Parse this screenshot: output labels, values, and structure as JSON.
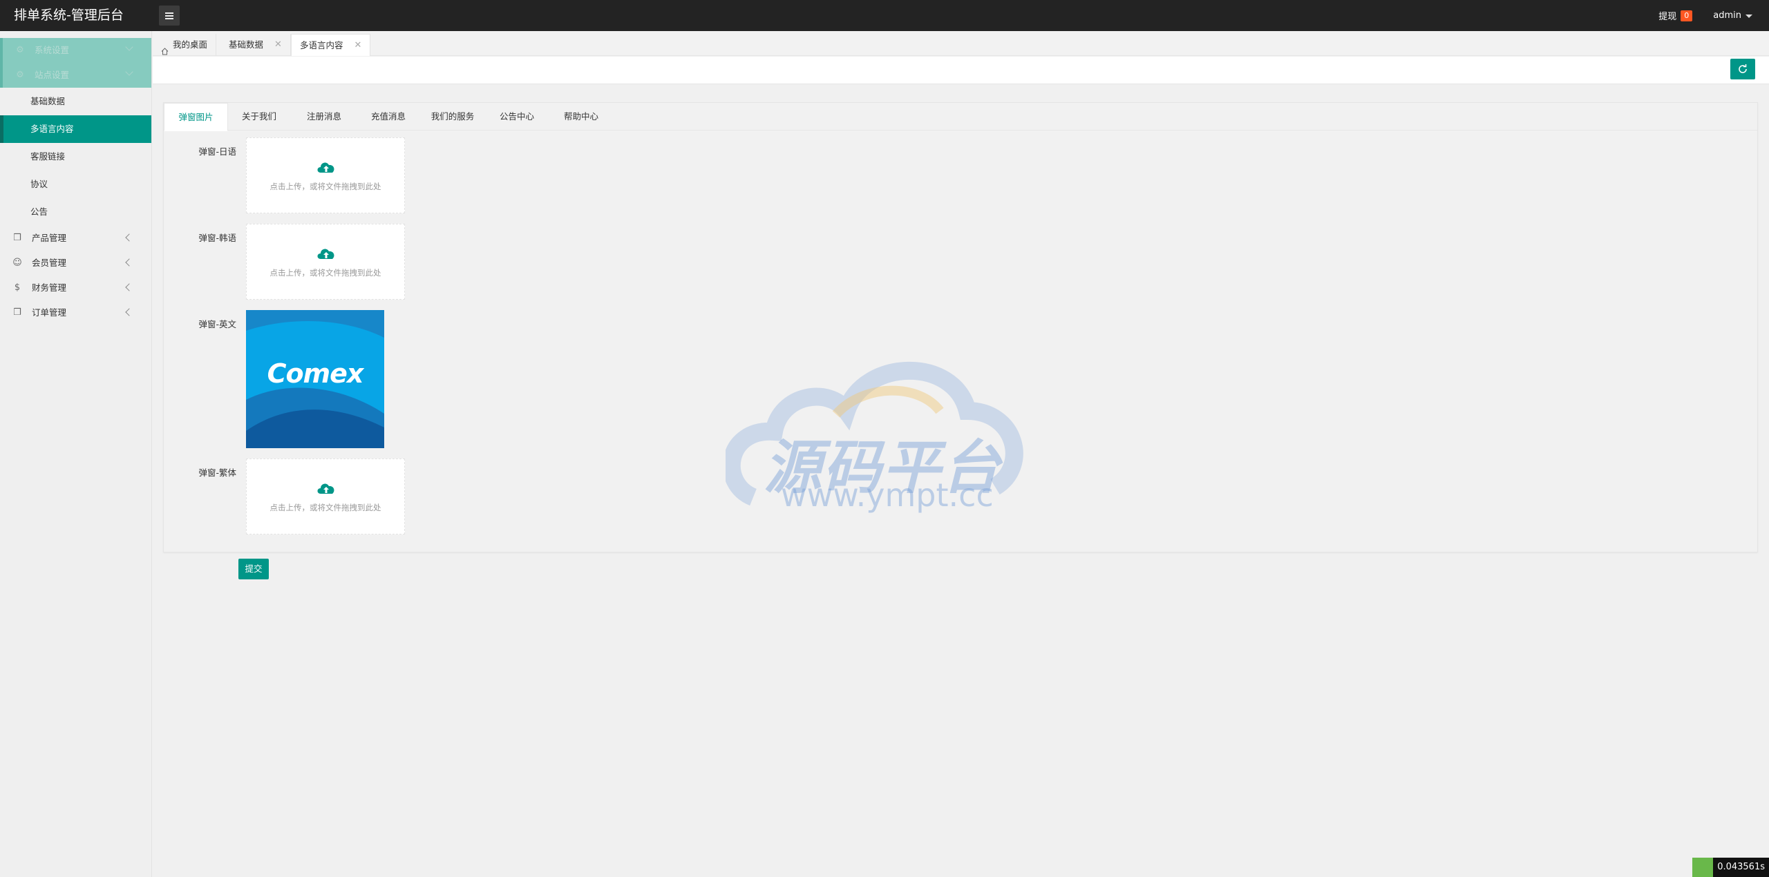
{
  "header": {
    "logo": "排单系统-管理后台",
    "withdraw_label": "提现",
    "withdraw_badge": "0",
    "user": "admin"
  },
  "sidebar": {
    "items": [
      {
        "label": "系统设置"
      },
      {
        "label": "站点设置"
      },
      {
        "label": "基础数据"
      },
      {
        "label": "多语言内容"
      },
      {
        "label": "客服链接"
      },
      {
        "label": "协议"
      },
      {
        "label": "公告"
      },
      {
        "label": "产品管理"
      },
      {
        "label": "会员管理"
      },
      {
        "label": "财务管理"
      },
      {
        "label": "订单管理"
      }
    ]
  },
  "page_tabs": [
    {
      "label": "我的桌面"
    },
    {
      "label": "基础数据"
    },
    {
      "label": "多语言内容"
    }
  ],
  "content_tabs": [
    {
      "label": "弹窗图片"
    },
    {
      "label": "关于我们"
    },
    {
      "label": "注册消息"
    },
    {
      "label": "充值消息"
    },
    {
      "label": "我们的服务"
    },
    {
      "label": "公告中心"
    },
    {
      "label": "帮助中心"
    }
  ],
  "form": {
    "rows": [
      {
        "label": "弹窗-日语"
      },
      {
        "label": "弹窗-韩语"
      },
      {
        "label": "弹窗-英文"
      },
      {
        "label": "弹窗-繁体"
      }
    ],
    "upload_hint": "点击上传，或将文件拖拽到此处",
    "preview_brand": "Comex",
    "submit_label": "提交"
  },
  "watermark": {
    "text": "源码平台",
    "url": "www.ympt.cc"
  },
  "timer": "0.043561s",
  "colors": {
    "accent": "#009688",
    "header_bg": "#232323",
    "badge": "#ff5722"
  }
}
